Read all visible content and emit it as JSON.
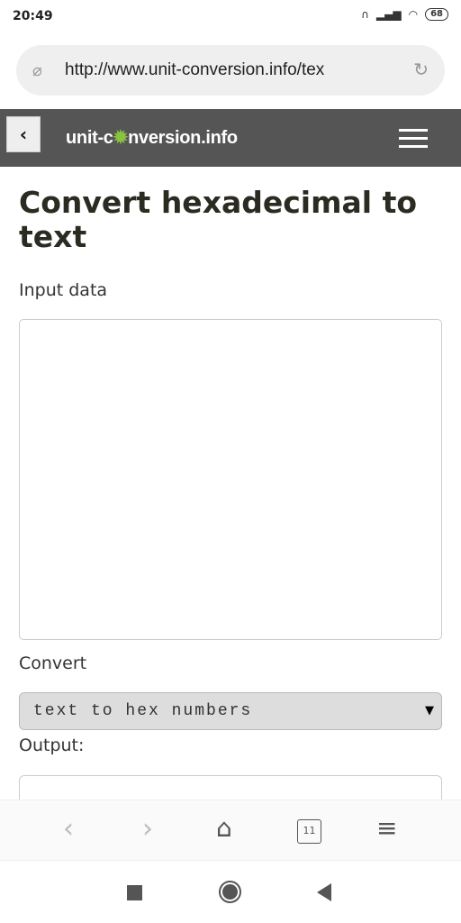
{
  "status": {
    "time": "20:49",
    "battery": "68"
  },
  "browser": {
    "url": "http://www.unit-conversion.info/tex",
    "tab_count": "11"
  },
  "site": {
    "logo_pre": "unit-c",
    "logo_post": "nversion.info"
  },
  "page": {
    "title": "Convert hexadecimal to text",
    "input_label": "Input data",
    "convert_label": "Convert",
    "convert_selected": "text to hex numbers",
    "output_label": "Output:"
  }
}
